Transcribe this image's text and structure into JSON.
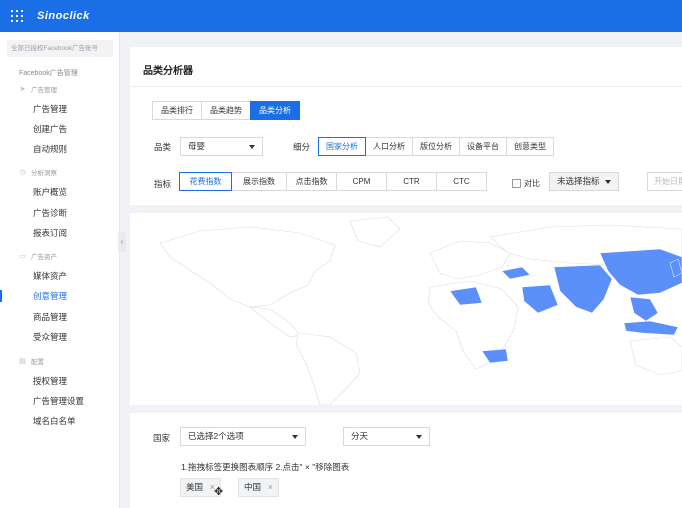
{
  "topbar": {
    "logo": "Sinoclick"
  },
  "sidebar": {
    "account_placeholder": "全部已授权Facebook广告账号",
    "section_title": "Facebook广告管理",
    "groups": [
      {
        "label": "广告管理",
        "icon": "send-icon",
        "items": [
          "广告管理",
          "创建广告",
          "自动规则"
        ]
      },
      {
        "label": "分析洞察",
        "icon": "chart-icon",
        "items": [
          "账户概览",
          "广告诊断",
          "报表订阅"
        ]
      },
      {
        "label": "广告资产",
        "icon": "folder-icon",
        "items": [
          "媒体资产",
          "创意管理",
          "商品管理",
          "受众管理"
        ]
      },
      {
        "label": "配置",
        "icon": "doc-icon",
        "items": [
          "授权管理",
          "广告管理设置",
          "域名白名单"
        ]
      }
    ],
    "active_item": "创意管理"
  },
  "page": {
    "title": "品类分析器",
    "tabs": [
      "品类排行",
      "品类趋势",
      "品类分析"
    ],
    "active_tab": "品类分析"
  },
  "filters": {
    "category_label": "品类",
    "category_value": "母婴",
    "breakdown_label": "细分",
    "breakdown_options": [
      "国家分析",
      "人口分析",
      "版位分析",
      "设备平台",
      "创意类型"
    ],
    "breakdown_active": "国家分析",
    "metric_label": "指标",
    "metric_options": [
      "花费指数",
      "展示指数",
      "点击指数",
      "CPM",
      "CTR",
      "CTC"
    ],
    "metric_active": "花费指数",
    "compare_label": "对比",
    "compare_select": "未选择指标",
    "date_placeholder": "开始日期"
  },
  "bottom": {
    "country_label": "国家",
    "country_select": "已选择2个选项",
    "period_select": "分天",
    "hint": "1.拖拽标签更换图表顺序  2.点击\" × \"移除图表",
    "chips": [
      "美国",
      "中国"
    ]
  },
  "colors": {
    "primary": "#1a6fe6",
    "map_highlight": "#5b8ff9",
    "map_base": "#ffffff"
  }
}
